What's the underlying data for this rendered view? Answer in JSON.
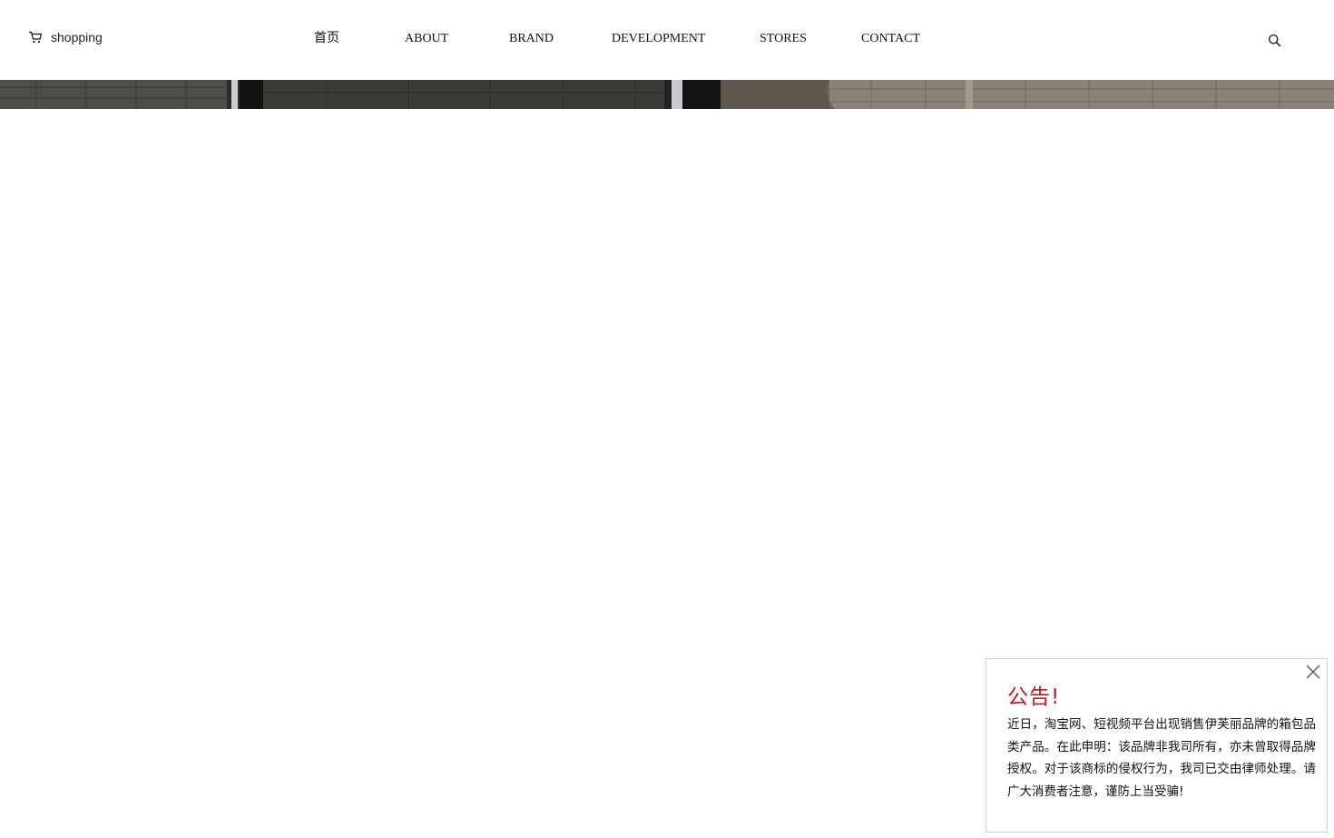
{
  "header": {
    "shopping_label": "shopping",
    "nav": [
      {
        "label": "首页"
      },
      {
        "label": "ABOUT"
      },
      {
        "label": "BRAND"
      },
      {
        "label": "DEVELOPMENT"
      },
      {
        "label": "STORES"
      },
      {
        "label": "CONTACT"
      }
    ],
    "icons": {
      "cart": "cart-icon",
      "search": "search-icon"
    }
  },
  "notice": {
    "title": "公告!",
    "body": "近日，淘宝网、短视频平台出现销售伊芙丽品牌的箱包品类产品。在此申明：该品牌非我司所有，亦未曾取得品牌授权。对于该商标的侵权行为，我司已交由律师处理。请广大消费者注意，谨防上当受骗!",
    "close_icon": "close-icon",
    "title_color": "#c4161c"
  }
}
